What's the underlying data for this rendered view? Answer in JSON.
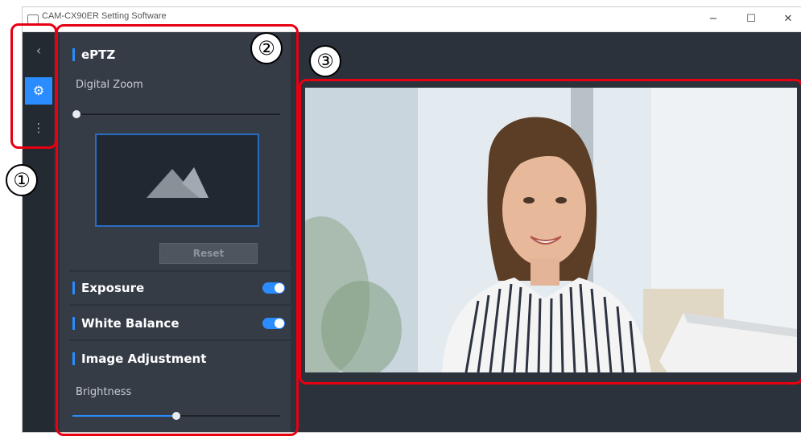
{
  "window": {
    "title": "CAM-CX90ER Setting Software",
    "controls": {
      "minimize": "−",
      "maximize": "☐",
      "close": "✕"
    }
  },
  "icon_bar": {
    "items": [
      {
        "icon": "chevron-left-icon",
        "glyph": "‹"
      },
      {
        "icon": "gear-icon",
        "glyph": "⚙",
        "active": true
      },
      {
        "icon": "more-vertical-icon",
        "glyph": "⋮"
      }
    ]
  },
  "panel": {
    "eptz": {
      "title": "ePTZ",
      "digital_zoom_label": "Digital Zoom",
      "digital_zoom_value": 0,
      "reset_label": "Reset"
    },
    "exposure": {
      "title": "Exposure",
      "enabled": true
    },
    "white_balance": {
      "title": "White Balance",
      "enabled": true
    },
    "image_adjustment": {
      "title": "Image Adjustment",
      "brightness_label": "Brightness",
      "brightness_value": 0.5
    }
  },
  "annotations": {
    "marker_1": "①",
    "marker_2": "②",
    "marker_3": "③"
  },
  "colors": {
    "accent": "#2a8cff",
    "background": "#2b323b",
    "panel": "#353c46",
    "annotation_red": "#e60012"
  }
}
